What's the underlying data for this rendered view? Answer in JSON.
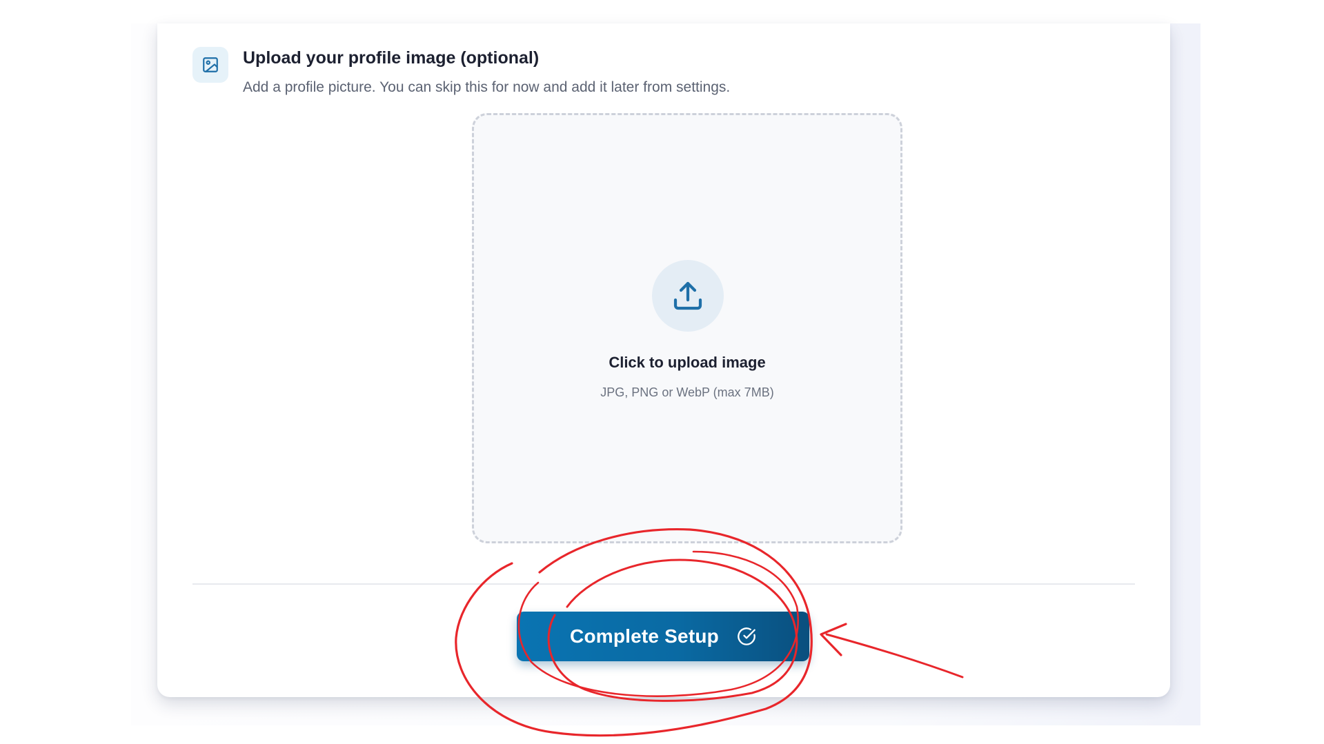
{
  "upload_section": {
    "icon": "image-icon",
    "title": "Upload your profile image (optional)",
    "description": "Add a profile picture. You can skip this for now and add it later from settings."
  },
  "dropzone": {
    "icon": "upload-icon",
    "title": "Click to upload image",
    "hint": "JPG, PNG or WebP (max 7MB)"
  },
  "footer": {
    "complete_label": "Complete Setup",
    "complete_icon": "check-circle-icon"
  },
  "colors": {
    "accent": "#0A6AA3",
    "icon_tint": "#1E6FA8",
    "annotation": "#E8262B"
  }
}
